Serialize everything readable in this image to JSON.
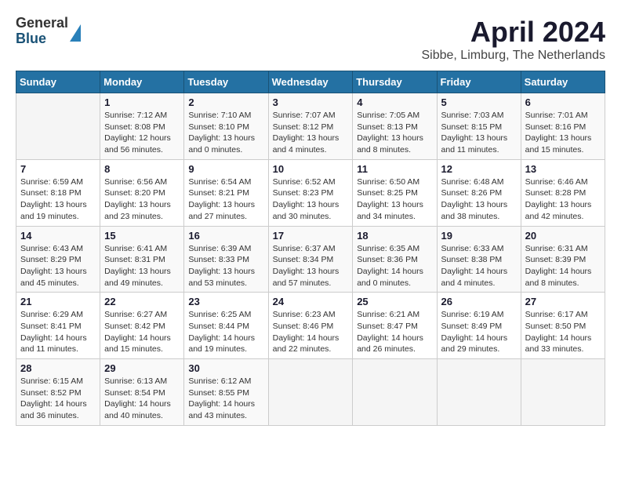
{
  "logo": {
    "general": "General",
    "blue": "Blue"
  },
  "title": "April 2024",
  "subtitle": "Sibbe, Limburg, The Netherlands",
  "days_of_week": [
    "Sunday",
    "Monday",
    "Tuesday",
    "Wednesday",
    "Thursday",
    "Friday",
    "Saturday"
  ],
  "weeks": [
    [
      {
        "day": "",
        "info": ""
      },
      {
        "day": "1",
        "info": "Sunrise: 7:12 AM\nSunset: 8:08 PM\nDaylight: 12 hours\nand 56 minutes."
      },
      {
        "day": "2",
        "info": "Sunrise: 7:10 AM\nSunset: 8:10 PM\nDaylight: 13 hours\nand 0 minutes."
      },
      {
        "day": "3",
        "info": "Sunrise: 7:07 AM\nSunset: 8:12 PM\nDaylight: 13 hours\nand 4 minutes."
      },
      {
        "day": "4",
        "info": "Sunrise: 7:05 AM\nSunset: 8:13 PM\nDaylight: 13 hours\nand 8 minutes."
      },
      {
        "day": "5",
        "info": "Sunrise: 7:03 AM\nSunset: 8:15 PM\nDaylight: 13 hours\nand 11 minutes."
      },
      {
        "day": "6",
        "info": "Sunrise: 7:01 AM\nSunset: 8:16 PM\nDaylight: 13 hours\nand 15 minutes."
      }
    ],
    [
      {
        "day": "7",
        "info": "Sunrise: 6:59 AM\nSunset: 8:18 PM\nDaylight: 13 hours\nand 19 minutes."
      },
      {
        "day": "8",
        "info": "Sunrise: 6:56 AM\nSunset: 8:20 PM\nDaylight: 13 hours\nand 23 minutes."
      },
      {
        "day": "9",
        "info": "Sunrise: 6:54 AM\nSunset: 8:21 PM\nDaylight: 13 hours\nand 27 minutes."
      },
      {
        "day": "10",
        "info": "Sunrise: 6:52 AM\nSunset: 8:23 PM\nDaylight: 13 hours\nand 30 minutes."
      },
      {
        "day": "11",
        "info": "Sunrise: 6:50 AM\nSunset: 8:25 PM\nDaylight: 13 hours\nand 34 minutes."
      },
      {
        "day": "12",
        "info": "Sunrise: 6:48 AM\nSunset: 8:26 PM\nDaylight: 13 hours\nand 38 minutes."
      },
      {
        "day": "13",
        "info": "Sunrise: 6:46 AM\nSunset: 8:28 PM\nDaylight: 13 hours\nand 42 minutes."
      }
    ],
    [
      {
        "day": "14",
        "info": "Sunrise: 6:43 AM\nSunset: 8:29 PM\nDaylight: 13 hours\nand 45 minutes."
      },
      {
        "day": "15",
        "info": "Sunrise: 6:41 AM\nSunset: 8:31 PM\nDaylight: 13 hours\nand 49 minutes."
      },
      {
        "day": "16",
        "info": "Sunrise: 6:39 AM\nSunset: 8:33 PM\nDaylight: 13 hours\nand 53 minutes."
      },
      {
        "day": "17",
        "info": "Sunrise: 6:37 AM\nSunset: 8:34 PM\nDaylight: 13 hours\nand 57 minutes."
      },
      {
        "day": "18",
        "info": "Sunrise: 6:35 AM\nSunset: 8:36 PM\nDaylight: 14 hours\nand 0 minutes."
      },
      {
        "day": "19",
        "info": "Sunrise: 6:33 AM\nSunset: 8:38 PM\nDaylight: 14 hours\nand 4 minutes."
      },
      {
        "day": "20",
        "info": "Sunrise: 6:31 AM\nSunset: 8:39 PM\nDaylight: 14 hours\nand 8 minutes."
      }
    ],
    [
      {
        "day": "21",
        "info": "Sunrise: 6:29 AM\nSunset: 8:41 PM\nDaylight: 14 hours\nand 11 minutes."
      },
      {
        "day": "22",
        "info": "Sunrise: 6:27 AM\nSunset: 8:42 PM\nDaylight: 14 hours\nand 15 minutes."
      },
      {
        "day": "23",
        "info": "Sunrise: 6:25 AM\nSunset: 8:44 PM\nDaylight: 14 hours\nand 19 minutes."
      },
      {
        "day": "24",
        "info": "Sunrise: 6:23 AM\nSunset: 8:46 PM\nDaylight: 14 hours\nand 22 minutes."
      },
      {
        "day": "25",
        "info": "Sunrise: 6:21 AM\nSunset: 8:47 PM\nDaylight: 14 hours\nand 26 minutes."
      },
      {
        "day": "26",
        "info": "Sunrise: 6:19 AM\nSunset: 8:49 PM\nDaylight: 14 hours\nand 29 minutes."
      },
      {
        "day": "27",
        "info": "Sunrise: 6:17 AM\nSunset: 8:50 PM\nDaylight: 14 hours\nand 33 minutes."
      }
    ],
    [
      {
        "day": "28",
        "info": "Sunrise: 6:15 AM\nSunset: 8:52 PM\nDaylight: 14 hours\nand 36 minutes."
      },
      {
        "day": "29",
        "info": "Sunrise: 6:13 AM\nSunset: 8:54 PM\nDaylight: 14 hours\nand 40 minutes."
      },
      {
        "day": "30",
        "info": "Sunrise: 6:12 AM\nSunset: 8:55 PM\nDaylight: 14 hours\nand 43 minutes."
      },
      {
        "day": "",
        "info": ""
      },
      {
        "day": "",
        "info": ""
      },
      {
        "day": "",
        "info": ""
      },
      {
        "day": "",
        "info": ""
      }
    ]
  ]
}
